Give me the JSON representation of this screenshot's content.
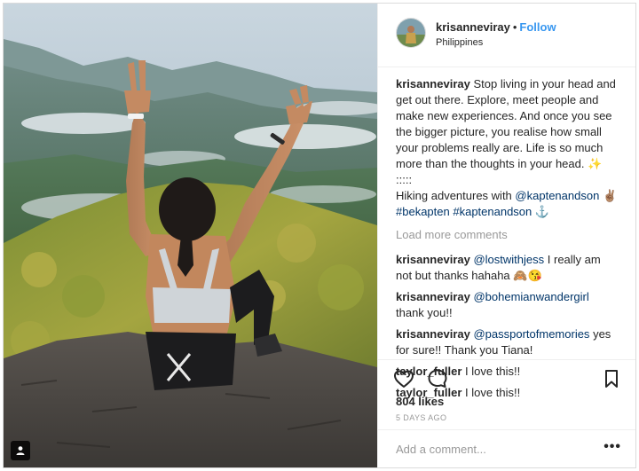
{
  "colors": {
    "link": "#3897f0",
    "mention": "#003569",
    "muted": "#999999",
    "text": "#262626",
    "border": "#efefef"
  },
  "header": {
    "username": "krisanneviray",
    "separator": "•",
    "follow_label": "Follow",
    "location": "Philippines"
  },
  "caption": {
    "username": "krisanneviray",
    "text_1": "Stop living in your head and get out there. Explore, meet people and make new experiences. And once you see the bigger picture, you realise how small your problems really are. Life is so much more than the thoughts in your head. ✨",
    "dots": ":::::",
    "text_2": "Hiking adventures with",
    "mention": "@kaptenandson",
    "emoji": "✌🏽",
    "hashtag_1": "#bekapten",
    "hashtag_2": "#kaptenandson",
    "anchor": "⚓"
  },
  "load_more": "Load more comments",
  "comments": [
    {
      "user": "krisanneviray",
      "mention": "@lostwithjess",
      "text": "I really am not but thanks hahaha 🙈😘"
    },
    {
      "user": "krisanneviray",
      "mention": "@bohemianwandergirl",
      "text": "thank you!!"
    },
    {
      "user": "krisanneviray",
      "mention": "@passportofmemories",
      "text": "yes for sure!! Thank you Tiana!"
    },
    {
      "user": "taylor_fuller",
      "mention": "",
      "text": "I love this!!"
    },
    {
      "user": "taylor_fuller",
      "mention": "",
      "text": "I love this!!"
    }
  ],
  "actions": {
    "like_icon": "heart-icon",
    "comment_icon": "comment-bubble-icon",
    "save_icon": "bookmark-icon"
  },
  "likes": "804 likes",
  "time_ago": "5 DAYS AGO",
  "add_comment": {
    "placeholder": "Add a comment...",
    "more_label": "•••"
  }
}
